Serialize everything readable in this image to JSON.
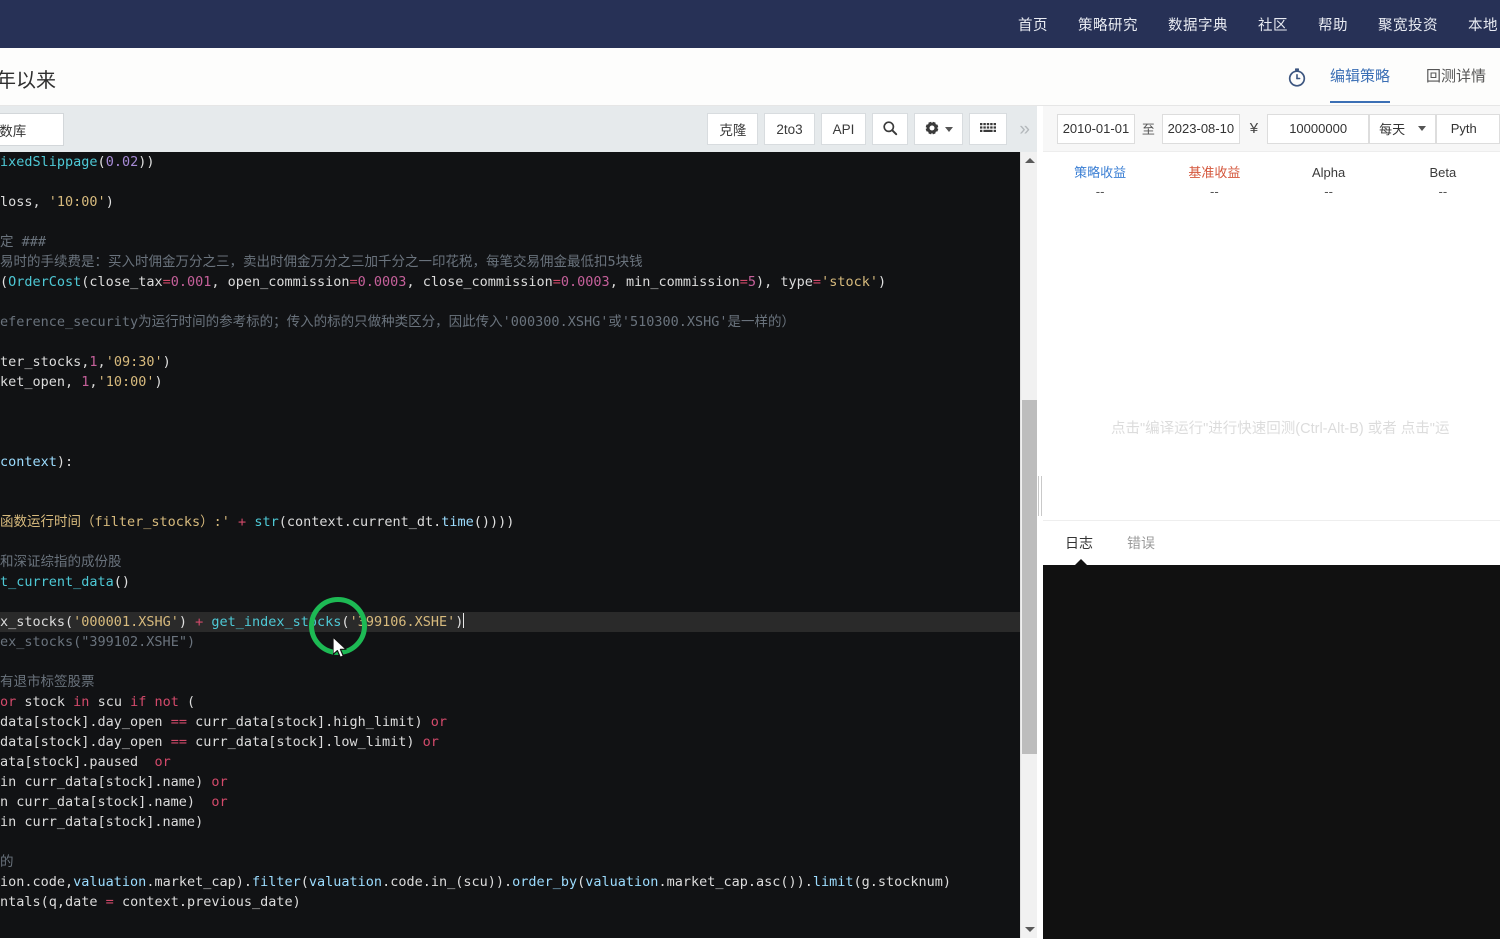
{
  "top_nav": {
    "items": [
      {
        "label": "首页",
        "name": "nav-home"
      },
      {
        "label": "策略研究",
        "name": "nav-strategy-research"
      },
      {
        "label": "数据字典",
        "name": "nav-data-dictionary"
      },
      {
        "label": "社区",
        "name": "nav-community"
      },
      {
        "label": "帮助",
        "name": "nav-help"
      },
      {
        "label": "聚宽投资",
        "name": "nav-joinquant-invest"
      },
      {
        "label": "本地",
        "name": "nav-local"
      }
    ],
    "bg_color": "#273156"
  },
  "sub_header": {
    "title": "年以来",
    "stopwatch_icon": "stopwatch-icon",
    "tabs": [
      {
        "label": "编辑策略",
        "active": true
      },
      {
        "label": "回测详情",
        "active": false
      }
    ],
    "accent_color": "#3b6fb5"
  },
  "editor": {
    "file_tab": "函数库",
    "toolbar": {
      "clone": "克隆",
      "to3": "2to3",
      "api": "API",
      "search_icon": "search-icon",
      "settings_icon": "gear-icon",
      "keyboard_icon": "keyboard-icon",
      "more": "»"
    },
    "scrollbar": {
      "up_arrow": "chevron-up-icon",
      "down_arrow": "chevron-down-icon"
    },
    "code_lines": [
      [
        {
          "t": "ixedSlippage",
          "c": "t-fn"
        },
        {
          "t": "(",
          "c": "t-paren"
        },
        {
          "t": "0.02",
          "c": "t-num"
        },
        {
          "t": "))",
          "c": "t-paren"
        }
      ],
      [],
      [
        {
          "t": "loss, ",
          "c": "t-plain"
        },
        {
          "t": "'10:00'",
          "c": "t-str"
        },
        {
          "t": ")",
          "c": "t-paren"
        }
      ],
      [],
      [
        {
          "t": "定 ###",
          "c": "t-cmt"
        }
      ],
      [
        {
          "t": "易时的手续费是：买入时佣金万分之三，卖出时佣金万分之三加千分之一印花税，每笔交易佣金最低扣5块钱",
          "c": "t-cmt"
        }
      ],
      [
        {
          "t": "(",
          "c": "t-paren"
        },
        {
          "t": "OrderCost",
          "c": "t-fn"
        },
        {
          "t": "(close_tax",
          "c": "t-plain"
        },
        {
          "t": "=",
          "c": "t-op"
        },
        {
          "t": "0.001",
          "c": "t-num2"
        },
        {
          "t": ", open_commission",
          "c": "t-plain"
        },
        {
          "t": "=",
          "c": "t-op"
        },
        {
          "t": "0.0003",
          "c": "t-num2"
        },
        {
          "t": ", close_commission",
          "c": "t-plain"
        },
        {
          "t": "=",
          "c": "t-op"
        },
        {
          "t": "0.0003",
          "c": "t-num2"
        },
        {
          "t": ", min_commission",
          "c": "t-plain"
        },
        {
          "t": "=",
          "c": "t-op"
        },
        {
          "t": "5",
          "c": "t-num2"
        },
        {
          "t": "), type",
          "c": "t-plain"
        },
        {
          "t": "=",
          "c": "t-op"
        },
        {
          "t": "'stock'",
          "c": "t-str"
        },
        {
          "t": ")",
          "c": "t-paren"
        }
      ],
      [],
      [
        {
          "t": "eference_security为运行时间的参考标的；传入的标的只做种类区分，因此传入'000300.XSHG'或'510300.XSHG'是一样的）",
          "c": "t-cmt"
        }
      ],
      [],
      [
        {
          "t": "ter_stocks,",
          "c": "t-plain"
        },
        {
          "t": "1",
          "c": "t-num2"
        },
        {
          "t": ",",
          "c": "t-plain"
        },
        {
          "t": "'09:30'",
          "c": "t-str"
        },
        {
          "t": ")",
          "c": "t-paren"
        }
      ],
      [
        {
          "t": "ket_open, ",
          "c": "t-plain"
        },
        {
          "t": "1",
          "c": "t-num2"
        },
        {
          "t": ",",
          "c": "t-plain"
        },
        {
          "t": "'10:00'",
          "c": "t-str"
        },
        {
          "t": ")",
          "c": "t-paren"
        }
      ],
      [],
      [],
      [],
      [
        {
          "t": "context",
          "c": "t-attr"
        },
        {
          "t": "):",
          "c": "t-plain"
        }
      ],
      [],
      [],
      [
        {
          "t": "函数运行时间（filter_stocks）:'",
          "c": "t-str"
        },
        {
          "t": " + ",
          "c": "t-op"
        },
        {
          "t": "str",
          "c": "t-fn"
        },
        {
          "t": "(context.current_dt.",
          "c": "t-plain"
        },
        {
          "t": "time",
          "c": "t-attr"
        },
        {
          "t": "())))",
          "c": "t-paren"
        }
      ],
      [],
      [
        {
          "t": "和深证综指的成份股",
          "c": "t-cmt"
        }
      ],
      [
        {
          "t": "t_current_data",
          "c": "t-fn"
        },
        {
          "t": "()",
          "c": "t-paren"
        }
      ],
      [],
      [
        {
          "t": "x_stocks",
          "c": "t-plain"
        },
        {
          "t": "(",
          "c": "t-paren"
        },
        {
          "t": "'000001.XSHG'",
          "c": "t-str"
        },
        {
          "t": ") ",
          "c": "t-paren"
        },
        {
          "t": "+",
          "c": "t-op"
        },
        {
          "t": " get_index_stocks",
          "c": "t-fn"
        },
        {
          "t": "(",
          "c": "t-paren"
        },
        {
          "t": "'399106.XSHE'",
          "c": "t-str"
        },
        {
          "t": ")",
          "c": "t-paren"
        }
      ],
      [
        {
          "t": "ex_stocks",
          "c": "t-cmt"
        },
        {
          "t": "(\"399102.XSHE\")",
          "c": "t-cmt"
        }
      ],
      [],
      [
        {
          "t": "有退市标签股票",
          "c": "t-cmt"
        }
      ],
      [
        {
          "t": "or",
          "c": "t-kw"
        },
        {
          "t": " stock ",
          "c": "t-plain"
        },
        {
          "t": "in",
          "c": "t-kw"
        },
        {
          "t": " scu ",
          "c": "t-plain"
        },
        {
          "t": "if",
          "c": "t-kw"
        },
        {
          "t": " ",
          "c": "t-plain"
        },
        {
          "t": "not",
          "c": "t-kw"
        },
        {
          "t": " (",
          "c": "t-plain"
        }
      ],
      [
        {
          "t": "data[stock].day_open ",
          "c": "t-plain"
        },
        {
          "t": "==",
          "c": "t-op"
        },
        {
          "t": " curr_data[stock].high_limit) ",
          "c": "t-plain"
        },
        {
          "t": "or",
          "c": "t-kw"
        }
      ],
      [
        {
          "t": "data[stock].day_open ",
          "c": "t-plain"
        },
        {
          "t": "==",
          "c": "t-op"
        },
        {
          "t": " curr_data[stock].low_limit) ",
          "c": "t-plain"
        },
        {
          "t": "or",
          "c": "t-kw"
        }
      ],
      [
        {
          "t": "ata[stock].paused  ",
          "c": "t-plain"
        },
        {
          "t": "or",
          "c": "t-kw"
        }
      ],
      [
        {
          "t": "in curr_data[stock].name) ",
          "c": "t-plain"
        },
        {
          "t": "or",
          "c": "t-kw"
        }
      ],
      [
        {
          "t": "n curr_data[stock].name)  ",
          "c": "t-plain"
        },
        {
          "t": "or",
          "c": "t-kw"
        }
      ],
      [
        {
          "t": "in curr_data[stock].name)",
          "c": "t-plain"
        }
      ],
      [],
      [
        {
          "t": "的",
          "c": "t-cmt"
        }
      ],
      [
        {
          "t": "ion.code,",
          "c": "t-plain"
        },
        {
          "t": "valuation",
          "c": "t-attr"
        },
        {
          "t": ".market_cap).",
          "c": "t-plain"
        },
        {
          "t": "filter",
          "c": "t-attr"
        },
        {
          "t": "(",
          "c": "t-paren"
        },
        {
          "t": "valuation",
          "c": "t-attr"
        },
        {
          "t": ".code.in_(scu)).",
          "c": "t-plain"
        },
        {
          "t": "order_by",
          "c": "t-attr"
        },
        {
          "t": "(",
          "c": "t-paren"
        },
        {
          "t": "valuation",
          "c": "t-attr"
        },
        {
          "t": ".market_cap.asc()).",
          "c": "t-plain"
        },
        {
          "t": "limit",
          "c": "t-attr"
        },
        {
          "t": "(g.stocknum)",
          "c": "t-plain"
        }
      ],
      [
        {
          "t": "ntals",
          "c": "t-plain"
        },
        {
          "t": "(q,date ",
          "c": "t-plain"
        },
        {
          "t": "=",
          "c": "t-op"
        },
        {
          "t": " context.previous_date)",
          "c": "t-plain"
        }
      ]
    ],
    "active_line_index": 23,
    "cursor_visible": true
  },
  "params": {
    "date_start": "2010-01-01",
    "date_separator": "至",
    "date_end": "2023-08-10",
    "currency_symbol": "¥",
    "capital": "10000000",
    "frequency": "每天",
    "language": "Pyth"
  },
  "stats": [
    {
      "label": "策略收益",
      "value": "--",
      "tone": "blue"
    },
    {
      "label": "基准收益",
      "value": "--",
      "tone": "red"
    },
    {
      "label": "Alpha",
      "value": "--",
      "tone": "dark"
    },
    {
      "label": "Beta",
      "value": "--",
      "tone": "dark"
    }
  ],
  "chart": {
    "hint": "点击\"编译运行\"进行快速回测(Ctrl-Alt-B) 或者 点击\"运"
  },
  "log": {
    "tabs": [
      {
        "label": "日志",
        "active": true
      },
      {
        "label": "错误",
        "active": false
      }
    ],
    "console_text": ""
  }
}
